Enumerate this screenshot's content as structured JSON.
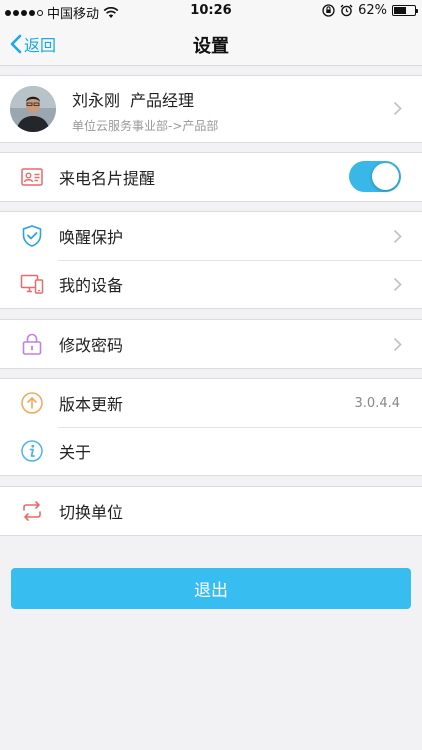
{
  "status_bar": {
    "carrier": "中国移动",
    "time": "10:26",
    "battery_percent": "62%",
    "battery_level": 0.62,
    "icons": [
      "signal-dots",
      "wifi-icon",
      "rotation-lock-icon",
      "alarm-icon",
      "battery-icon"
    ]
  },
  "nav": {
    "back_label": "返回",
    "title": "设置"
  },
  "profile": {
    "name": "刘永刚",
    "role": "产品经理",
    "department": "单位云服务事业部->产品部"
  },
  "caller_card": {
    "label": "来电名片提醒",
    "enabled": true
  },
  "security": {
    "items": [
      {
        "label": "唤醒保护",
        "icon": "shield-check-icon"
      },
      {
        "label": "我的设备",
        "icon": "devices-icon"
      }
    ]
  },
  "password": {
    "label": "修改密码",
    "icon": "lock-icon"
  },
  "about": {
    "items": [
      {
        "label": "版本更新",
        "value": "3.0.4.4",
        "icon": "upload-arrow-icon"
      },
      {
        "label": "关于",
        "icon": "info-icon"
      }
    ]
  },
  "switch_unit": {
    "label": "切换单位",
    "icon": "switch-arrows-icon"
  },
  "logout": {
    "label": "退出"
  },
  "colors": {
    "accent": "#38bdf0",
    "nav_text": "#1aa7ec",
    "toggle_on": "#38b7e8",
    "background": "#f2f2f4"
  }
}
